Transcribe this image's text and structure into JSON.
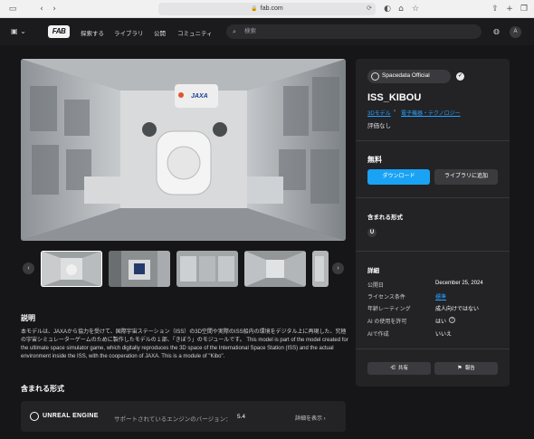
{
  "browser": {
    "url": "fab.com"
  },
  "nav": {
    "logo": "FAB",
    "links": [
      "探索する",
      "ライブラリ",
      "公開",
      "コミュニティ"
    ],
    "search_placeholder": "検索",
    "avatar_initial": "A"
  },
  "gallery": {
    "thumb_count": 5,
    "selected_index": 0
  },
  "description": {
    "title": "説明",
    "text": "本モデルは、JAXAから協力を受けて、国際宇宙ステーション（ISS）の3D空間や実際のISS船内の環境をデジタル上に再現した、究極の宇宙シミュレーターゲームのために製作したモデルの１部、「きぼう」のモジュールです。 This model is part of the model created for the ultimate space simulator game, which digitally reproduces the 3D space of the International Space Station (ISS) and the actual environment inside the ISS, with the cooperation of JAXA. This is a module of \"Kibo\"."
  },
  "included_formats_section": {
    "title": "含まれる形式",
    "engine_name": "UNREAL ENGINE",
    "version_label": "サポートされているエンジンのバージョン：",
    "version_value": "5.4",
    "details_link": "詳細を表示 ›"
  },
  "panel": {
    "publisher": "Spacedata Official",
    "title": "ISS_KIBOU",
    "breadcrumb": [
      "3Dモデル",
      "電子機器・テクノロジー"
    ],
    "rating": "評価なし",
    "price": "無料",
    "download_label": "ダウンロード",
    "add_library_label": "ライブラリに追加",
    "formats_title": "含まれる形式",
    "format_icon_letter": "U",
    "details_title": "詳細",
    "details": [
      {
        "label": "公開日",
        "value": "December 25, 2024"
      },
      {
        "label": "ライセンス条件",
        "value": "標準"
      },
      {
        "label": "年齢レーティング",
        "value": "成人向けではない"
      },
      {
        "label": "AI の使用を許可",
        "value": "はい"
      },
      {
        "label": "AIで作成",
        "value": "いいえ"
      }
    ],
    "share_label": "共有",
    "report_label": "報告"
  },
  "colors": {
    "accent": "#1aa3f5",
    "link": "#26a0ff",
    "panel": "#232326"
  }
}
